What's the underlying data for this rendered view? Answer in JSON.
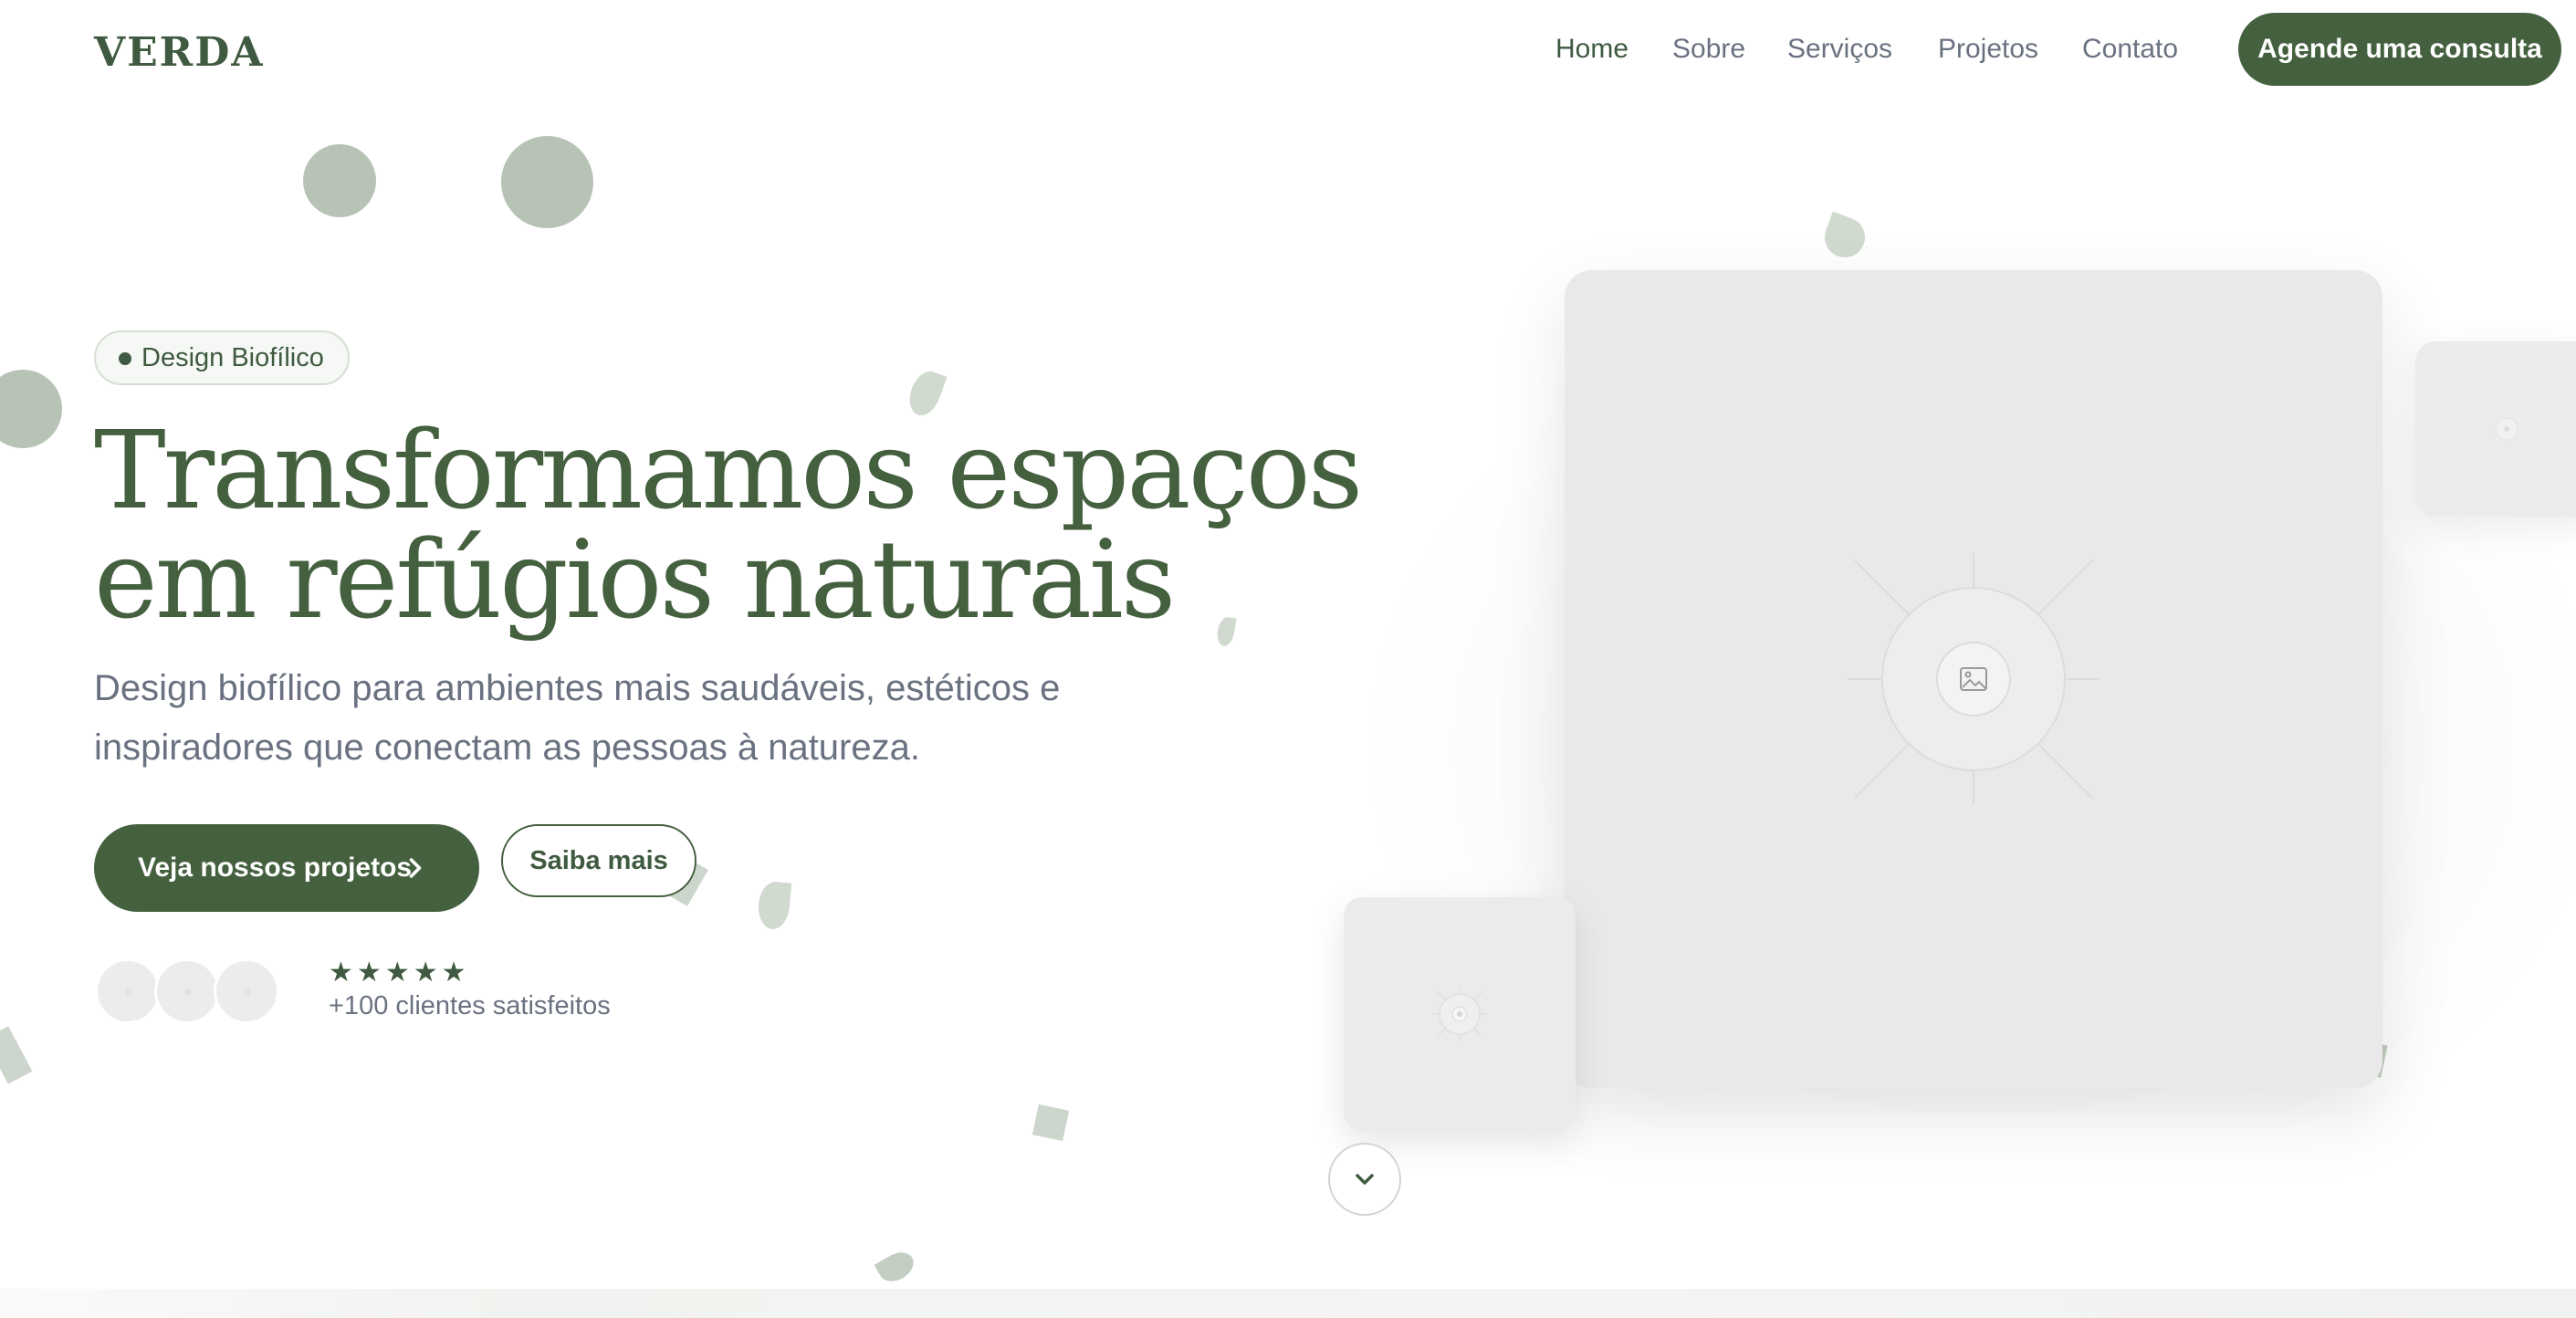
{
  "header": {
    "logo": "VERDA",
    "nav": [
      {
        "label": "Home",
        "active": true
      },
      {
        "label": "Sobre",
        "active": false
      },
      {
        "label": "Serviços",
        "active": false
      },
      {
        "label": "Projetos",
        "active": false
      },
      {
        "label": "Contato",
        "active": false
      }
    ],
    "cta_label": "Agende uma consulta"
  },
  "hero": {
    "badge": "Design Biofílico",
    "headline_line1": "Transformamos espaços",
    "headline_line2": "em refúgios naturais",
    "subtitle": "Design biofílico para ambientes mais saudáveis, estéticos e inspiradores que conectam as pessoas à natureza.",
    "primary_button": "Veja nossos projetos",
    "secondary_button": "Saiba mais",
    "rating_stars": 5,
    "clients_text": "+100 clientes satisfeitos"
  },
  "icons": {
    "primary_button_icon": "chevron-right-icon",
    "scroll_icon": "chevron-down-icon",
    "image_placeholder_icon": "image-icon",
    "star_icon": "star-icon"
  },
  "colors": {
    "brand": "#44603f",
    "muted_text": "#6a7180",
    "decor": "#b6c3b5",
    "placeholder": "#e9e9e9"
  }
}
